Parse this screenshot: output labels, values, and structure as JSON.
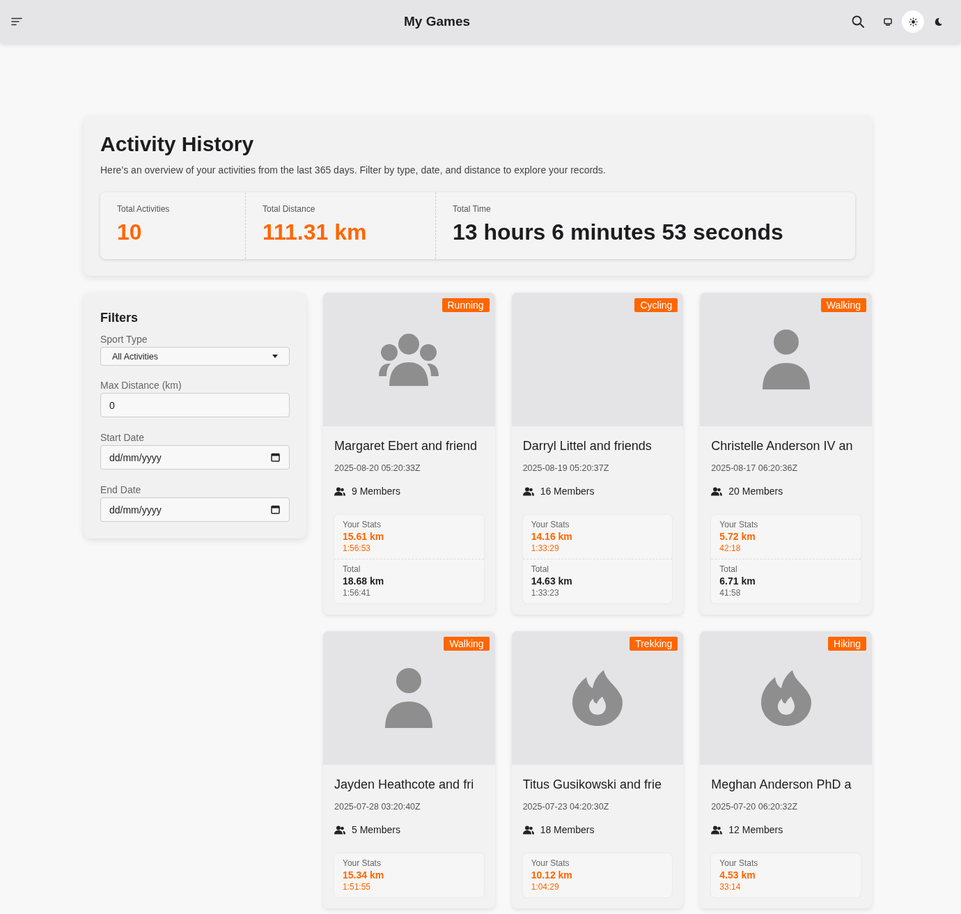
{
  "header": {
    "title": "My Games",
    "theme_options": [
      {
        "kind": "system",
        "selected": false
      },
      {
        "kind": "light",
        "selected": true
      },
      {
        "kind": "dark",
        "selected": false
      }
    ]
  },
  "summary": {
    "title": "Activity History",
    "description": "Here’s an overview of your activities from the last 365 days. Filter by type, date, and distance to explore your records.",
    "stats": [
      {
        "label": "Total Activities",
        "value": "10",
        "accent": true
      },
      {
        "label": "Total Distance",
        "value": "111.31 km",
        "accent": true
      },
      {
        "label": "Total Time",
        "value": "13 hours 6 minutes 53 seconds",
        "accent": false
      }
    ]
  },
  "filters": {
    "title": "Filters",
    "fields": [
      {
        "kind": "select",
        "label": "Sport Type",
        "value": "All Activities"
      },
      {
        "kind": "number",
        "label": "Max Distance (km)",
        "value": "0"
      },
      {
        "kind": "date",
        "label": "Start Date",
        "placeholder": "dd/mm/yyyy"
      },
      {
        "kind": "date",
        "label": "End Date",
        "placeholder": "dd/mm/yyyy"
      }
    ]
  },
  "activities": [
    {
      "sport": "Running",
      "kind": "group",
      "title": "Margaret Ebert and friend",
      "date": "2025-08-20 05:20:33Z",
      "members": "9 Members",
      "your_label": "Your Stats",
      "your_distance": "15.61 km",
      "your_time": "1:56:53",
      "total_label": "Total",
      "total_distance": "18.68 km",
      "total_time": "1:56:41"
    },
    {
      "sport": "Cycling",
      "kind": "none",
      "title": "Darryl Littel and friends",
      "date": "2025-08-19 05:20:37Z",
      "members": "16 Members",
      "your_label": "Your Stats",
      "your_distance": "14.16 km",
      "your_time": "1:33:29",
      "total_label": "Total",
      "total_distance": "14.63 km",
      "total_time": "1:33:23"
    },
    {
      "sport": "Walking",
      "kind": "person",
      "title": "Christelle Anderson IV an",
      "date": "2025-08-17 06:20:36Z",
      "members": "20 Members",
      "your_label": "Your Stats",
      "your_distance": "5.72 km",
      "your_time": "42:18",
      "total_label": "Total",
      "total_distance": "6.71 km",
      "total_time": "41:58"
    },
    {
      "sport": "Walking",
      "kind": "person",
      "title": "Jayden Heathcote and fri",
      "date": "2025-07-28 03:20:40Z",
      "members": "5 Members",
      "your_label": "Your Stats",
      "your_distance": "15.34 km",
      "your_time": "1:51:55"
    },
    {
      "sport": "Trekking",
      "kind": "flame",
      "title": "Titus Gusikowski and frie",
      "date": "2025-07-23 04:20:30Z",
      "members": "18 Members",
      "your_label": "Your Stats",
      "your_distance": "10.12 km",
      "your_time": "1:04:29"
    },
    {
      "sport": "Hiking",
      "kind": "flame",
      "title": "Meghan Anderson PhD a",
      "date": "2025-07-20 06:20:32Z",
      "members": "12 Members",
      "your_label": "Your Stats",
      "your_distance": "4.53 km",
      "your_time": "33:14"
    }
  ]
}
